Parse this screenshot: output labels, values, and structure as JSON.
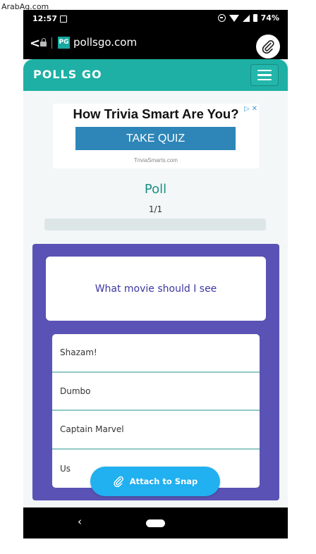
{
  "watermark": "ArabAg.com",
  "status_bar": {
    "time": "12:57",
    "battery_percent": "74%",
    "icons": [
      "image-icon",
      "do-not-disturb-icon",
      "wifi-icon",
      "signal-icon",
      "battery-icon"
    ]
  },
  "browser": {
    "url": "pollsgo.com",
    "favicon_text": "PG",
    "icons": [
      "back-chevron-icon",
      "lock-icon",
      "paperclip-icon"
    ]
  },
  "header": {
    "logo": "POLLS GO",
    "accent_color": "#1fb0a5"
  },
  "ad": {
    "title": "How Trivia Smart Are You?",
    "cta": "TAKE QUIZ",
    "source": "TriviaSmarts.com",
    "corner_icons": "▷ ✕"
  },
  "poll": {
    "title": "Poll",
    "counter": "1/1",
    "progress_fraction": 1.0,
    "question": "What movie should I see",
    "options": [
      "Shazam!",
      "Dumbo",
      "Captain Marvel",
      "Us"
    ],
    "card_color": "#5a53b5"
  },
  "attach_button": {
    "label": "Attach to Snap",
    "color": "#21b0f0"
  },
  "nav": {
    "back_glyph": "‹"
  }
}
